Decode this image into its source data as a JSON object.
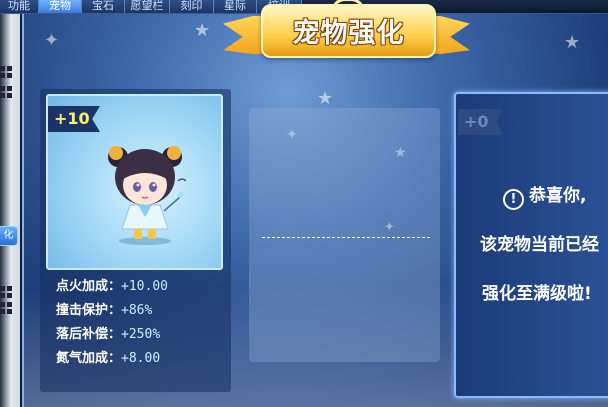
{
  "tabs": [
    {
      "label": "功能",
      "active": false
    },
    {
      "label": "宠物",
      "active": true
    },
    {
      "label": "宝石",
      "active": false
    },
    {
      "label": "愿望栏",
      "active": false
    },
    {
      "label": "刻印",
      "active": false
    },
    {
      "label": "星际",
      "active": false
    },
    {
      "label": "培训",
      "active": false
    }
  ],
  "left_strip": {
    "button_label": "化"
  },
  "title": "宠物强化",
  "pet": {
    "level": "+10",
    "stats": [
      {
        "label": "点火加成：",
        "value": "+10.00"
      },
      {
        "label": "撞击保护：",
        "value": "+86%"
      },
      {
        "label": "落后补偿：",
        "value": "+250%"
      },
      {
        "label": "氮气加成：",
        "value": "+8.00"
      }
    ]
  },
  "target": {
    "level": "+0",
    "message_lines": [
      "恭喜你,",
      "该宠物当前已经",
      "强化至满级啦!"
    ]
  },
  "colors": {
    "accent": "#f2a51c",
    "panel_bg": "#1f3f7a",
    "stat_value": "#c8f0ff",
    "level_text": "#fff06a"
  }
}
